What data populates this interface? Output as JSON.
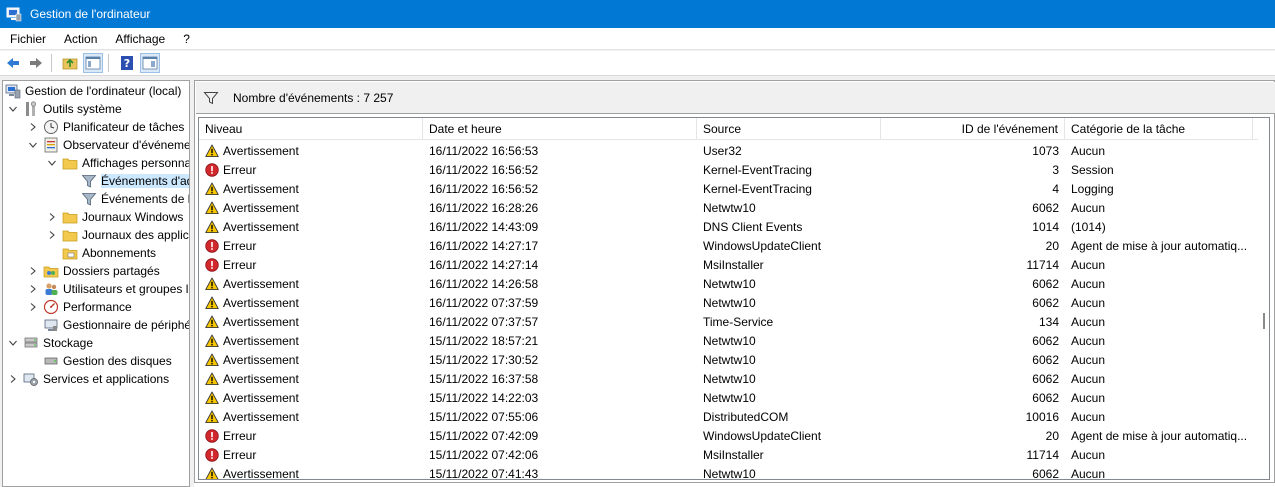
{
  "window": {
    "title": "Gestion de l'ordinateur"
  },
  "menu": [
    "Fichier",
    "Action",
    "Affichage",
    "?"
  ],
  "toolbar": {
    "buttons": [
      "back-arrow-icon",
      "forward-arrow-icon",
      "up-folder-icon",
      "show-hide-tree-icon",
      "help-icon",
      "action-pane-icon"
    ]
  },
  "tree": [
    {
      "label": "Gestion de l'ordinateur (local)",
      "level": 0,
      "twisty": "",
      "icon": "computer-management-icon"
    },
    {
      "label": "Outils système",
      "level": 1,
      "twisty": "expanded",
      "icon": "tools-icon"
    },
    {
      "label": "Planificateur de tâches",
      "level": 2,
      "twisty": "collapsed",
      "icon": "clock-icon"
    },
    {
      "label": "Observateur d'événeme",
      "level": 2,
      "twisty": "expanded",
      "icon": "event-viewer-icon"
    },
    {
      "label": "Affichages personna",
      "level": 3,
      "twisty": "expanded",
      "icon": "folder-icon"
    },
    {
      "label": "Événements d'ad",
      "level": 4,
      "twisty": "",
      "icon": "filter-icon",
      "selected": true
    },
    {
      "label": "Événements de l",
      "level": 4,
      "twisty": "",
      "icon": "filter-icon"
    },
    {
      "label": "Journaux Windows",
      "level": 3,
      "twisty": "collapsed",
      "icon": "folder-icon"
    },
    {
      "label": "Journaux des applic",
      "level": 3,
      "twisty": "collapsed",
      "icon": "folder-icon"
    },
    {
      "label": "Abonnements",
      "level": 3,
      "twisty": "",
      "icon": "subscriptions-icon"
    },
    {
      "label": "Dossiers partagés",
      "level": 2,
      "twisty": "collapsed",
      "icon": "shared-folder-icon"
    },
    {
      "label": "Utilisateurs et groupes l",
      "level": 2,
      "twisty": "collapsed",
      "icon": "users-icon"
    },
    {
      "label": "Performance",
      "level": 2,
      "twisty": "collapsed",
      "icon": "performance-icon"
    },
    {
      "label": "Gestionnaire de périphé",
      "level": 2,
      "twisty": "",
      "icon": "device-manager-icon"
    },
    {
      "label": "Stockage",
      "level": 1,
      "twisty": "expanded",
      "icon": "storage-icon"
    },
    {
      "label": "Gestion des disques",
      "level": 2,
      "twisty": "",
      "icon": "disk-icon"
    },
    {
      "label": "Services et applications",
      "level": 1,
      "twisty": "collapsed",
      "icon": "services-icon"
    }
  ],
  "filter": {
    "text": "Nombre d'événements : 7 257"
  },
  "grid": {
    "columns": [
      "Niveau",
      "Date et heure",
      "Source",
      "ID de l'événement",
      "Catégorie de la tâche"
    ],
    "rows": [
      {
        "level": "warning",
        "niveau": "Avertissement",
        "date": "16/11/2022 16:56:53",
        "source": "User32",
        "id": "1073",
        "cat": "Aucun"
      },
      {
        "level": "error",
        "niveau": "Erreur",
        "date": "16/11/2022 16:56:52",
        "source": "Kernel-EventTracing",
        "id": "3",
        "cat": "Session"
      },
      {
        "level": "warning",
        "niveau": "Avertissement",
        "date": "16/11/2022 16:56:52",
        "source": "Kernel-EventTracing",
        "id": "4",
        "cat": "Logging"
      },
      {
        "level": "warning",
        "niveau": "Avertissement",
        "date": "16/11/2022 16:28:26",
        "source": "Netwtw10",
        "id": "6062",
        "cat": "Aucun"
      },
      {
        "level": "warning",
        "niveau": "Avertissement",
        "date": "16/11/2022 14:43:09",
        "source": "DNS Client Events",
        "id": "1014",
        "cat": "(1014)"
      },
      {
        "level": "error",
        "niveau": "Erreur",
        "date": "16/11/2022 14:27:17",
        "source": "WindowsUpdateClient",
        "id": "20",
        "cat": "Agent de mise à jour automatiq..."
      },
      {
        "level": "error",
        "niveau": "Erreur",
        "date": "16/11/2022 14:27:14",
        "source": "MsiInstaller",
        "id": "11714",
        "cat": "Aucun"
      },
      {
        "level": "warning",
        "niveau": "Avertissement",
        "date": "16/11/2022 14:26:58",
        "source": "Netwtw10",
        "id": "6062",
        "cat": "Aucun"
      },
      {
        "level": "warning",
        "niveau": "Avertissement",
        "date": "16/11/2022 07:37:59",
        "source": "Netwtw10",
        "id": "6062",
        "cat": "Aucun"
      },
      {
        "level": "warning",
        "niveau": "Avertissement",
        "date": "16/11/2022 07:37:57",
        "source": "Time-Service",
        "id": "134",
        "cat": "Aucun"
      },
      {
        "level": "warning",
        "niveau": "Avertissement",
        "date": "15/11/2022 18:57:21",
        "source": "Netwtw10",
        "id": "6062",
        "cat": "Aucun"
      },
      {
        "level": "warning",
        "niveau": "Avertissement",
        "date": "15/11/2022 17:30:52",
        "source": "Netwtw10",
        "id": "6062",
        "cat": "Aucun"
      },
      {
        "level": "warning",
        "niveau": "Avertissement",
        "date": "15/11/2022 16:37:58",
        "source": "Netwtw10",
        "id": "6062",
        "cat": "Aucun"
      },
      {
        "level": "warning",
        "niveau": "Avertissement",
        "date": "15/11/2022 14:22:03",
        "source": "Netwtw10",
        "id": "6062",
        "cat": "Aucun"
      },
      {
        "level": "warning",
        "niveau": "Avertissement",
        "date": "15/11/2022 07:55:06",
        "source": "DistributedCOM",
        "id": "10016",
        "cat": "Aucun"
      },
      {
        "level": "error",
        "niveau": "Erreur",
        "date": "15/11/2022 07:42:09",
        "source": "WindowsUpdateClient",
        "id": "20",
        "cat": "Agent de mise à jour automatiq..."
      },
      {
        "level": "error",
        "niveau": "Erreur",
        "date": "15/11/2022 07:42:06",
        "source": "MsiInstaller",
        "id": "11714",
        "cat": "Aucun"
      },
      {
        "level": "warning",
        "niveau": "Avertissement",
        "date": "15/11/2022 07:41:43",
        "source": "Netwtw10",
        "id": "6062",
        "cat": "Aucun"
      }
    ]
  }
}
